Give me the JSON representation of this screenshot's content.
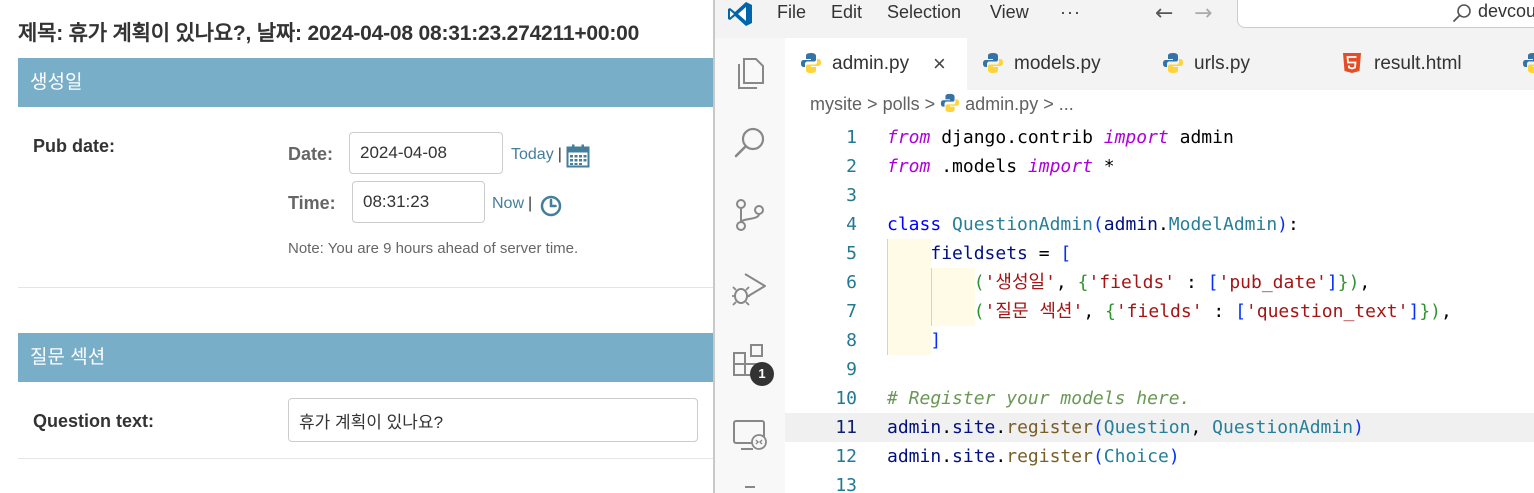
{
  "admin": {
    "page_title": "제목: 휴가 계획이 있나요?, 날짜: 2024-04-08 08:31:23.274211+00:00",
    "section1_title": "생성일",
    "pub_date_label": "Pub date:",
    "date_label": "Date:",
    "date_value": "2024-04-08",
    "today_link": "Today",
    "time_label": "Time:",
    "time_value": "08:31:23",
    "now_link": "Now",
    "separator": "|",
    "time_note": "Note: You are 9 hours ahead of server time.",
    "section2_title": "질문 섹션",
    "question_label": "Question text:",
    "question_value": "휴가 계획이 있나요?"
  },
  "vscode": {
    "menu": [
      "File",
      "Edit",
      "Selection",
      "View",
      "···"
    ],
    "search_text": "devcou",
    "tabs": [
      {
        "label": "admin.py",
        "active": true
      },
      {
        "label": "models.py",
        "active": false
      },
      {
        "label": "urls.py",
        "active": false
      },
      {
        "label": "result.html",
        "active": false
      }
    ],
    "tab_close": "×",
    "breadcrumb": [
      "mysite",
      "polls",
      "admin.py",
      "..."
    ],
    "breadcrumb_sep": ">",
    "extensions_badge": "1",
    "current_line": 11,
    "code": [
      {
        "n": "1",
        "tokens": [
          [
            "kw",
            "from"
          ],
          [
            "t",
            " django.contrib "
          ],
          [
            "kw",
            "import"
          ],
          [
            "t",
            " admin"
          ]
        ]
      },
      {
        "n": "2",
        "tokens": [
          [
            "kw",
            "from"
          ],
          [
            "t",
            " .models "
          ],
          [
            "kw",
            "import"
          ],
          [
            "t",
            " *"
          ]
        ]
      },
      {
        "n": "3",
        "tokens": []
      },
      {
        "n": "4",
        "tokens": [
          [
            "kwb",
            "class"
          ],
          [
            "t",
            " "
          ],
          [
            "cls",
            "QuestionAdmin"
          ],
          [
            "brk",
            "("
          ],
          [
            "var",
            "admin"
          ],
          [
            "t",
            "."
          ],
          [
            "cls",
            "ModelAdmin"
          ],
          [
            "brk",
            ")"
          ],
          [
            "t",
            ":"
          ]
        ]
      },
      {
        "n": "5",
        "tokens": [
          [
            "t",
            "    "
          ],
          [
            "var",
            "fieldsets"
          ],
          [
            "t",
            " = "
          ],
          [
            "brk",
            "["
          ]
        ]
      },
      {
        "n": "6",
        "tokens": [
          [
            "t",
            "        "
          ],
          [
            "brk2",
            "("
          ],
          [
            "str",
            "'생성일'"
          ],
          [
            "t",
            ", "
          ],
          [
            "brk2",
            "{"
          ],
          [
            "str",
            "'fields'"
          ],
          [
            "t",
            " : "
          ],
          [
            "brk",
            "["
          ],
          [
            "str",
            "'pub_date'"
          ],
          [
            "brk",
            "]"
          ],
          [
            "brk2",
            "}"
          ],
          [
            "brk2",
            ")"
          ],
          [
            "t",
            ","
          ]
        ]
      },
      {
        "n": "7",
        "tokens": [
          [
            "t",
            "        "
          ],
          [
            "brk2",
            "("
          ],
          [
            "str",
            "'질문 섹션'"
          ],
          [
            "t",
            ", "
          ],
          [
            "brk2",
            "{"
          ],
          [
            "str",
            "'fields'"
          ],
          [
            "t",
            " : "
          ],
          [
            "brk",
            "["
          ],
          [
            "str",
            "'question_text'"
          ],
          [
            "brk",
            "]"
          ],
          [
            "brk2",
            "}"
          ],
          [
            "brk2",
            ")"
          ],
          [
            "t",
            ","
          ]
        ]
      },
      {
        "n": "8",
        "tokens": [
          [
            "t",
            "    "
          ],
          [
            "brk",
            "]"
          ]
        ]
      },
      {
        "n": "9",
        "tokens": []
      },
      {
        "n": "10",
        "tokens": [
          [
            "cmt",
            "# Register your models here."
          ]
        ]
      },
      {
        "n": "11",
        "tokens": [
          [
            "var",
            "admin"
          ],
          [
            "t",
            "."
          ],
          [
            "var",
            "site"
          ],
          [
            "t",
            "."
          ],
          [
            "fn",
            "register"
          ],
          [
            "brk",
            "("
          ],
          [
            "cls",
            "Question"
          ],
          [
            "t",
            ", "
          ],
          [
            "cls",
            "QuestionAdmin"
          ],
          [
            "brk",
            ")"
          ]
        ]
      },
      {
        "n": "12",
        "tokens": [
          [
            "var",
            "admin"
          ],
          [
            "t",
            "."
          ],
          [
            "var",
            "site"
          ],
          [
            "t",
            "."
          ],
          [
            "fn",
            "register"
          ],
          [
            "brk",
            "("
          ],
          [
            "cls",
            "Choice"
          ],
          [
            "brk",
            ")"
          ]
        ]
      },
      {
        "n": "13",
        "tokens": []
      }
    ]
  },
  "colors": {
    "admin_module": "#79aec8",
    "admin_link": "#447e9b",
    "vscode_blue": "#007acc",
    "python_blue": "#3572a5",
    "python_yellow": "#ffd43b",
    "html_orange": "#e44d26"
  },
  "icons": [
    "calendar-icon",
    "clock-icon",
    "vscode-logo-icon",
    "explorer-icon",
    "search-icon",
    "source-control-icon",
    "run-debug-icon",
    "extensions-icon",
    "remote-explorer-icon",
    "python-file-icon",
    "html-file-icon",
    "arrow-left-icon",
    "arrow-right-icon"
  ]
}
